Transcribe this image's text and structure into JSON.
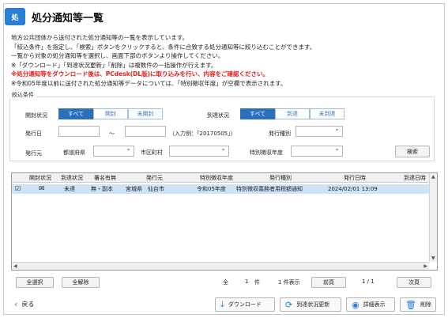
{
  "header": {
    "title": "処分通知等一覧",
    "logo_text": "処"
  },
  "intro": [
    "地方公共団体から送付された処分通知等の一覧を表示しています。",
    "「絞込条件」を指定し、「検索」ボタンをクリックすると、条件に合致する処分通知等に絞り込むことができます。",
    "一覧から対象の処分通知等を選択し、画面下部のボタンより操作してください。",
    "※「ダウンロード」「到達状況更新」「削除」は複数件の一括操作が行えます。",
    "※処分通知等をダウンロード後は、PCdesk(DL版)に取り込みを行い、内容をご確認ください。",
    "※令和05年度以前に送付された処分通知等データについては、「特別徴収年度」が空欄で表示されます。"
  ],
  "filter": {
    "title": "絞込条件",
    "open_status_label": "開封状況",
    "open_status_options": [
      "すべて",
      "開封",
      "未開封"
    ],
    "arrival_status_label": "到達状況",
    "arrival_status_options": [
      "すべて",
      "到達",
      "未到達"
    ],
    "issue_date_label": "発行日",
    "tilde": "～",
    "date_hint": "（入力例：「20170505」）",
    "issue_type_label": "発行種別",
    "issuer_label": "発行元",
    "prefecture_label": "都道府県",
    "city_label": "市区町村",
    "tax_year_label": "特別徴収年度",
    "search_button": "検索"
  },
  "table": {
    "columns": [
      "開封状況",
      "到達状況",
      "署名有無",
      "発行元",
      "特別徴収年度",
      "発行種別",
      "発行日時",
      "到達日時"
    ],
    "rows": [
      {
        "checked": "☑",
        "open_icon": "open-envelope",
        "arrival": "未達",
        "signature": "無・副本",
        "issuer": "宮城県　仙台市",
        "tax_year": "令和05年度",
        "type": "特別徴収義務者用税額通知",
        "issued_at": "2024/02/01 13:09",
        "arrived_at": ""
      }
    ]
  },
  "paging": {
    "select_all": "全選択",
    "deselect_all": "全解除",
    "total_prefix": "全",
    "total_count": "1",
    "total_suffix": "件",
    "shown": "1 件表示",
    "prev": "前頁",
    "page": "1 / 1",
    "next": "次頁"
  },
  "footer": {
    "back": "戻る",
    "download": "ダウンロード",
    "update_status": "到達状況更新",
    "details": "詳細表示",
    "delete": "削除"
  },
  "colors": {
    "accent": "#2c6fbd",
    "warning": "#e02020",
    "row_selected": "#cfe3f6"
  }
}
